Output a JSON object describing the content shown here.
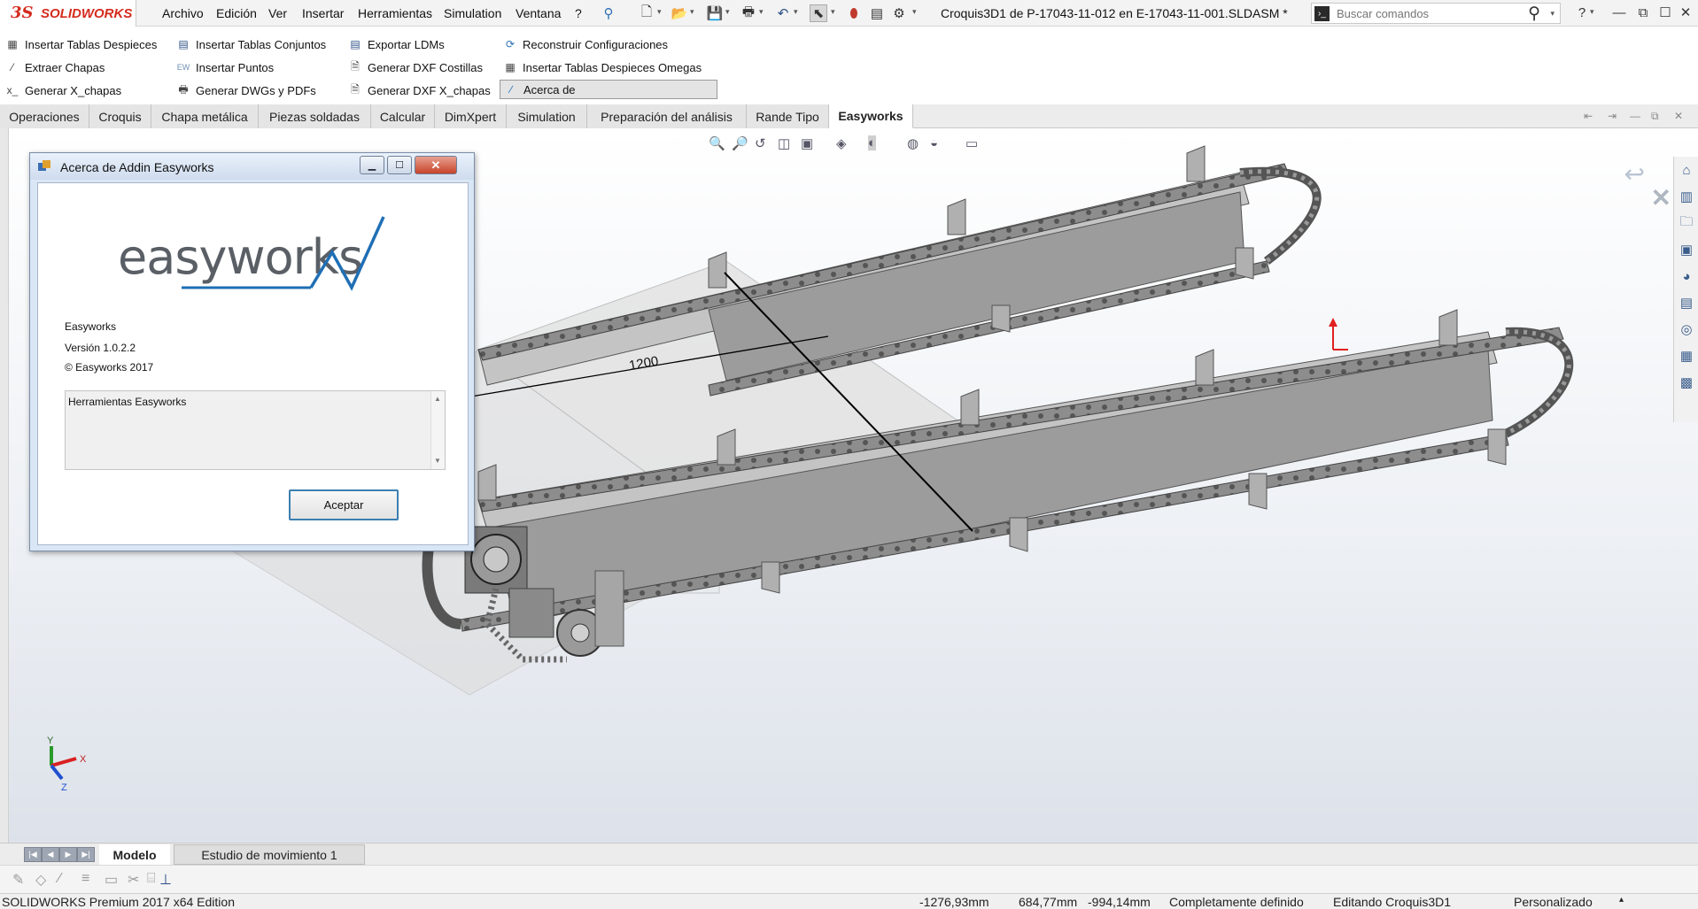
{
  "app": {
    "brand_mark": "3S",
    "brand_name": "SOLIDWORKS"
  },
  "menu": [
    "Archivo",
    "Edición",
    "Ver",
    "Insertar",
    "Herramientas",
    "Simulation",
    "Ventana",
    "?"
  ],
  "document_title": "Croquis3D1 de P-17043-11-012 en E-17043-11-001.SLDASM *",
  "search": {
    "placeholder": "Buscar comandos",
    "help": "?"
  },
  "commands": {
    "col1": [
      "Insertar Tablas Despieces",
      "Extraer Chapas",
      "Generar X_chapas"
    ],
    "col2": [
      "Insertar Tablas Conjuntos",
      "Insertar Puntos",
      "Generar DWGs y PDFs"
    ],
    "col3": [
      "Exportar LDMs",
      "Generar DXF Costillas",
      "Generar DXF X_chapas"
    ],
    "col4": [
      "Reconstruir Configuraciones",
      "Insertar Tablas Despieces Omegas",
      "Acerca de"
    ]
  },
  "tabs": [
    "Operaciones",
    "Croquis",
    "Chapa metálica",
    "Piezas soldadas",
    "Calcular",
    "DimXpert",
    "Simulation",
    "Preparación del análisis",
    "Rande Tipo",
    "Easyworks"
  ],
  "active_tab": "Easyworks",
  "dialog": {
    "title": "Acerca de Addin Easyworks",
    "logo_text": "easyworks",
    "product": "Easyworks",
    "version": "Versión 1.0.2.2",
    "copyright": "© Easyworks 2017",
    "description": "Herramientas Easyworks",
    "ok_label": "Aceptar"
  },
  "dimension_label": "1200",
  "triad": {
    "x": "X",
    "y": "Y",
    "z": "Z"
  },
  "bottom_tabs": [
    "Modelo",
    "Estudio de movimiento 1"
  ],
  "status": {
    "edition": "SOLIDWORKS Premium 2017 x64 Edition",
    "x": "-1276,93mm",
    "y": "684,77mm",
    "z": "-994,14mm",
    "definition": "Completamente definido",
    "editing": "Editando Croquis3D1",
    "units": "Personalizado"
  },
  "colors": {
    "brand": "#d52b1e",
    "logo_gray": "#5a5f66",
    "logo_blue": "#1f6fb5",
    "dialog_frame": "#d9e6f5",
    "ok_border": "#3c7fb1"
  },
  "icons": [
    "new-file-icon",
    "open-icon",
    "save-icon",
    "print-icon",
    "undo-icon",
    "select-icon",
    "rebuild-icon",
    "file-properties-icon",
    "options-icon",
    "pin-icon",
    "search-icon"
  ]
}
